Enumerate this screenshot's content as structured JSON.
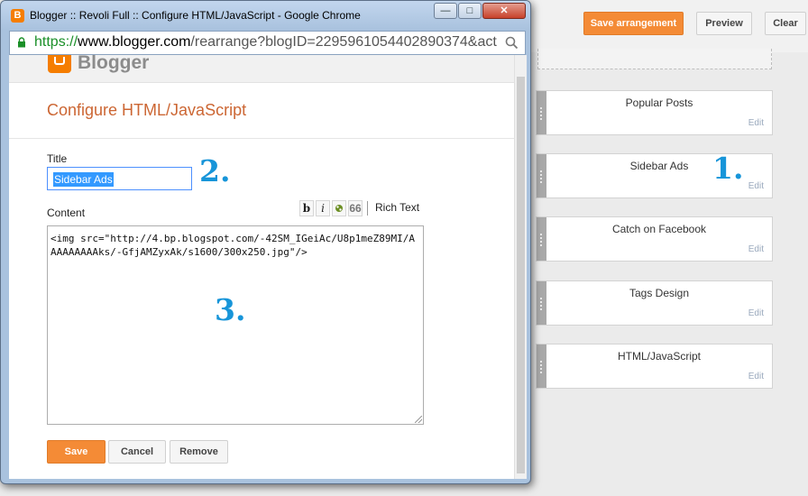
{
  "layout_page": {
    "buttons": {
      "save_arrangement": "Save arrangement",
      "preview": "Preview",
      "clear": "Clear"
    },
    "gadgets": [
      {
        "title": "Popular Posts",
        "edit": "Edit"
      },
      {
        "title": "Sidebar Ads",
        "edit": "Edit"
      },
      {
        "title": "Catch on Facebook",
        "edit": "Edit"
      },
      {
        "title": "Tags Design",
        "edit": "Edit"
      },
      {
        "title": "HTML/JavaScript",
        "edit": "Edit"
      }
    ]
  },
  "annotations": {
    "one": "1.",
    "two": "2.",
    "three": "3."
  },
  "window": {
    "title": "Blogger :: Revoli Full :: Configure HTML/JavaScript - Google Chrome",
    "favicon_letter": "B",
    "url": {
      "scheme": "https://",
      "host": "www.blogger.com",
      "path": "/rearrange?blogID=2295961054402890374&act"
    }
  },
  "dialog": {
    "brand": "Blogger",
    "heading": "Configure HTML/JavaScript",
    "title_label": "Title",
    "title_value": "Sidebar Ads",
    "content_label": "Content",
    "toolbar": {
      "bold": "b",
      "italic": "i",
      "quote": "66",
      "rich_text": "Rich Text"
    },
    "content_value": "<img src=\"http://4.bp.blogspot.com/-42SM_IGeiAc/U8p1meZ89MI/AAAAAAAAAks/-GfjAMZyxAk/s1600/300x250.jpg\"/>",
    "buttons": {
      "save": "Save",
      "cancel": "Cancel",
      "remove": "Remove"
    }
  },
  "colors": {
    "accent_orange": "#f48b36",
    "heading_orange": "#cc6633",
    "annotation_blue": "#1795d9",
    "url_green": "#1a8f28"
  },
  "icons": [
    "blogger-favicon-icon",
    "lock-icon",
    "search-icon",
    "bold-icon",
    "italic-icon",
    "link-icon",
    "quote-icon",
    "drag-handle-icon",
    "resize-grip-icon"
  ]
}
